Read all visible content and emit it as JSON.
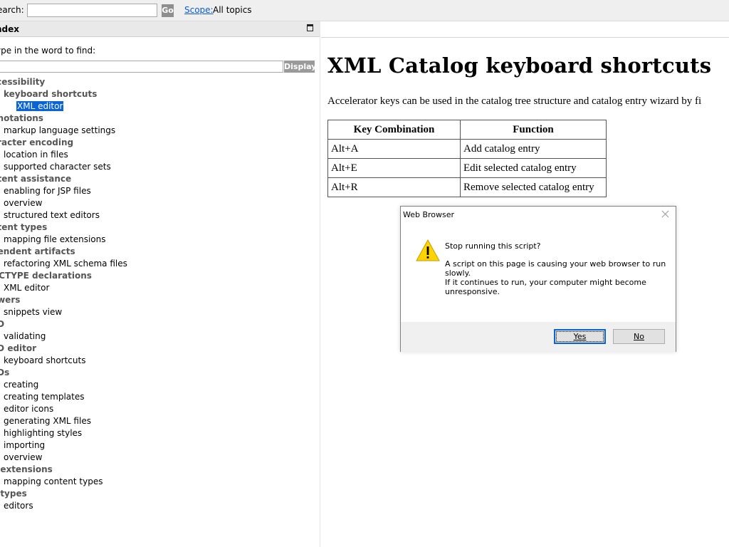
{
  "topbar": {
    "search_label": "earch:",
    "search_value": "",
    "go_label": "Go",
    "scope_label": "Scope:",
    "scope_value": "All topics"
  },
  "index": {
    "title": "ndex",
    "maximize_icon": "maximize-icon",
    "find_label": "ype in the word to find:",
    "find_value": "",
    "display_label": "Display",
    "items": [
      {
        "level": 0,
        "label": "ccessibility"
      },
      {
        "level": 1,
        "label": "keyboard shortcuts",
        "bold": true
      },
      {
        "level": 2,
        "label": "XML editor",
        "selected": true
      },
      {
        "level": 0,
        "label": "nnotations"
      },
      {
        "level": 1,
        "label": "markup language settings"
      },
      {
        "level": 0,
        "label": "aracter encoding"
      },
      {
        "level": 1,
        "label": "location in files"
      },
      {
        "level": 1,
        "label": "supported character sets"
      },
      {
        "level": 0,
        "label": "ntent assistance"
      },
      {
        "level": 1,
        "label": "enabling for JSP files"
      },
      {
        "level": 1,
        "label": "overview"
      },
      {
        "level": 1,
        "label": "structured text editors"
      },
      {
        "level": 0,
        "label": "ntent types"
      },
      {
        "level": 1,
        "label": "mapping file extensions"
      },
      {
        "level": 0,
        "label": "pendent artifacts"
      },
      {
        "level": 1,
        "label": "refactoring XML schema files"
      },
      {
        "level": 0,
        "label": "OCTYPE declarations"
      },
      {
        "level": 1,
        "label": "XML editor"
      },
      {
        "level": 0,
        "label": "awers"
      },
      {
        "level": 1,
        "label": "snippets view"
      },
      {
        "level": 0,
        "label": "TD"
      },
      {
        "level": 1,
        "label": "validating"
      },
      {
        "level": 0,
        "label": "TD editor"
      },
      {
        "level": 1,
        "label": "keyboard shortcuts"
      },
      {
        "level": 0,
        "label": "TDs"
      },
      {
        "level": 1,
        "label": "creating"
      },
      {
        "level": 1,
        "label": "creating templates"
      },
      {
        "level": 1,
        "label": "editor icons"
      },
      {
        "level": 1,
        "label": "generating XML files"
      },
      {
        "level": 1,
        "label": "highlighting styles"
      },
      {
        "level": 1,
        "label": "importing"
      },
      {
        "level": 1,
        "label": "overview"
      },
      {
        "level": 0,
        "label": "e extensions"
      },
      {
        "level": 1,
        "label": "mapping content types"
      },
      {
        "level": 0,
        "label": "e types"
      },
      {
        "level": 1,
        "label": "editors"
      }
    ]
  },
  "content": {
    "title": "XML Catalog keyboard shortcuts",
    "intro": "Accelerator keys can be used in the catalog tree structure and catalog entry wizard by fi",
    "table": {
      "headers": [
        "Key Combination",
        "Function"
      ],
      "rows": [
        [
          "Alt+A",
          "Add catalog entry"
        ],
        [
          "Alt+E",
          "Edit selected catalog entry"
        ],
        [
          "Alt+R",
          "Remove selected catalog entry"
        ]
      ]
    }
  },
  "dialog": {
    "title": "Web Browser",
    "heading": "Stop running this script?",
    "body_line1": "A script on this page is causing your web browser to run slowly.",
    "body_line2": "If it continues to run, your computer might become unresponsive.",
    "yes_label": "Yes",
    "no_label": "No",
    "warning_color": "#ffd400"
  }
}
